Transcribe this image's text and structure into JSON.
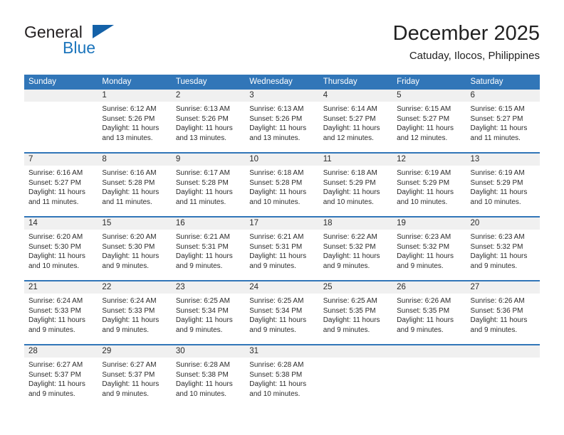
{
  "logo": {
    "word_top": "General",
    "word_bottom": "Blue",
    "triangle_color": "#1461a8",
    "blue_text_color": "#1c75bc"
  },
  "header": {
    "title": "December 2025",
    "subtitle": "Catuday, Ilocos, Philippines"
  },
  "colors": {
    "header_row_bg": "#3176b8",
    "day_band_bg": "#f0f0f0",
    "week_divider": "#3176b8",
    "text": "#2b2b2b"
  },
  "weekdays": [
    "Sunday",
    "Monday",
    "Tuesday",
    "Wednesday",
    "Thursday",
    "Friday",
    "Saturday"
  ],
  "weeks": [
    {
      "days": [
        {
          "number": "",
          "lines": []
        },
        {
          "number": "1",
          "lines": [
            "Sunrise: 6:12 AM",
            "Sunset: 5:26 PM",
            "Daylight: 11 hours",
            "and 13 minutes."
          ]
        },
        {
          "number": "2",
          "lines": [
            "Sunrise: 6:13 AM",
            "Sunset: 5:26 PM",
            "Daylight: 11 hours",
            "and 13 minutes."
          ]
        },
        {
          "number": "3",
          "lines": [
            "Sunrise: 6:13 AM",
            "Sunset: 5:26 PM",
            "Daylight: 11 hours",
            "and 13 minutes."
          ]
        },
        {
          "number": "4",
          "lines": [
            "Sunrise: 6:14 AM",
            "Sunset: 5:27 PM",
            "Daylight: 11 hours",
            "and 12 minutes."
          ]
        },
        {
          "number": "5",
          "lines": [
            "Sunrise: 6:15 AM",
            "Sunset: 5:27 PM",
            "Daylight: 11 hours",
            "and 12 minutes."
          ]
        },
        {
          "number": "6",
          "lines": [
            "Sunrise: 6:15 AM",
            "Sunset: 5:27 PM",
            "Daylight: 11 hours",
            "and 11 minutes."
          ]
        }
      ]
    },
    {
      "days": [
        {
          "number": "7",
          "lines": [
            "Sunrise: 6:16 AM",
            "Sunset: 5:27 PM",
            "Daylight: 11 hours",
            "and 11 minutes."
          ]
        },
        {
          "number": "8",
          "lines": [
            "Sunrise: 6:16 AM",
            "Sunset: 5:28 PM",
            "Daylight: 11 hours",
            "and 11 minutes."
          ]
        },
        {
          "number": "9",
          "lines": [
            "Sunrise: 6:17 AM",
            "Sunset: 5:28 PM",
            "Daylight: 11 hours",
            "and 11 minutes."
          ]
        },
        {
          "number": "10",
          "lines": [
            "Sunrise: 6:18 AM",
            "Sunset: 5:28 PM",
            "Daylight: 11 hours",
            "and 10 minutes."
          ]
        },
        {
          "number": "11",
          "lines": [
            "Sunrise: 6:18 AM",
            "Sunset: 5:29 PM",
            "Daylight: 11 hours",
            "and 10 minutes."
          ]
        },
        {
          "number": "12",
          "lines": [
            "Sunrise: 6:19 AM",
            "Sunset: 5:29 PM",
            "Daylight: 11 hours",
            "and 10 minutes."
          ]
        },
        {
          "number": "13",
          "lines": [
            "Sunrise: 6:19 AM",
            "Sunset: 5:29 PM",
            "Daylight: 11 hours",
            "and 10 minutes."
          ]
        }
      ]
    },
    {
      "days": [
        {
          "number": "14",
          "lines": [
            "Sunrise: 6:20 AM",
            "Sunset: 5:30 PM",
            "Daylight: 11 hours",
            "and 10 minutes."
          ]
        },
        {
          "number": "15",
          "lines": [
            "Sunrise: 6:20 AM",
            "Sunset: 5:30 PM",
            "Daylight: 11 hours",
            "and 9 minutes."
          ]
        },
        {
          "number": "16",
          "lines": [
            "Sunrise: 6:21 AM",
            "Sunset: 5:31 PM",
            "Daylight: 11 hours",
            "and 9 minutes."
          ]
        },
        {
          "number": "17",
          "lines": [
            "Sunrise: 6:21 AM",
            "Sunset: 5:31 PM",
            "Daylight: 11 hours",
            "and 9 minutes."
          ]
        },
        {
          "number": "18",
          "lines": [
            "Sunrise: 6:22 AM",
            "Sunset: 5:32 PM",
            "Daylight: 11 hours",
            "and 9 minutes."
          ]
        },
        {
          "number": "19",
          "lines": [
            "Sunrise: 6:23 AM",
            "Sunset: 5:32 PM",
            "Daylight: 11 hours",
            "and 9 minutes."
          ]
        },
        {
          "number": "20",
          "lines": [
            "Sunrise: 6:23 AM",
            "Sunset: 5:32 PM",
            "Daylight: 11 hours",
            "and 9 minutes."
          ]
        }
      ]
    },
    {
      "days": [
        {
          "number": "21",
          "lines": [
            "Sunrise: 6:24 AM",
            "Sunset: 5:33 PM",
            "Daylight: 11 hours",
            "and 9 minutes."
          ]
        },
        {
          "number": "22",
          "lines": [
            "Sunrise: 6:24 AM",
            "Sunset: 5:33 PM",
            "Daylight: 11 hours",
            "and 9 minutes."
          ]
        },
        {
          "number": "23",
          "lines": [
            "Sunrise: 6:25 AM",
            "Sunset: 5:34 PM",
            "Daylight: 11 hours",
            "and 9 minutes."
          ]
        },
        {
          "number": "24",
          "lines": [
            "Sunrise: 6:25 AM",
            "Sunset: 5:34 PM",
            "Daylight: 11 hours",
            "and 9 minutes."
          ]
        },
        {
          "number": "25",
          "lines": [
            "Sunrise: 6:25 AM",
            "Sunset: 5:35 PM",
            "Daylight: 11 hours",
            "and 9 minutes."
          ]
        },
        {
          "number": "26",
          "lines": [
            "Sunrise: 6:26 AM",
            "Sunset: 5:35 PM",
            "Daylight: 11 hours",
            "and 9 minutes."
          ]
        },
        {
          "number": "27",
          "lines": [
            "Sunrise: 6:26 AM",
            "Sunset: 5:36 PM",
            "Daylight: 11 hours",
            "and 9 minutes."
          ]
        }
      ]
    },
    {
      "days": [
        {
          "number": "28",
          "lines": [
            "Sunrise: 6:27 AM",
            "Sunset: 5:37 PM",
            "Daylight: 11 hours",
            "and 9 minutes."
          ]
        },
        {
          "number": "29",
          "lines": [
            "Sunrise: 6:27 AM",
            "Sunset: 5:37 PM",
            "Daylight: 11 hours",
            "and 9 minutes."
          ]
        },
        {
          "number": "30",
          "lines": [
            "Sunrise: 6:28 AM",
            "Sunset: 5:38 PM",
            "Daylight: 11 hours",
            "and 10 minutes."
          ]
        },
        {
          "number": "31",
          "lines": [
            "Sunrise: 6:28 AM",
            "Sunset: 5:38 PM",
            "Daylight: 11 hours",
            "and 10 minutes."
          ]
        },
        {
          "number": "",
          "lines": []
        },
        {
          "number": "",
          "lines": []
        },
        {
          "number": "",
          "lines": []
        }
      ]
    }
  ]
}
